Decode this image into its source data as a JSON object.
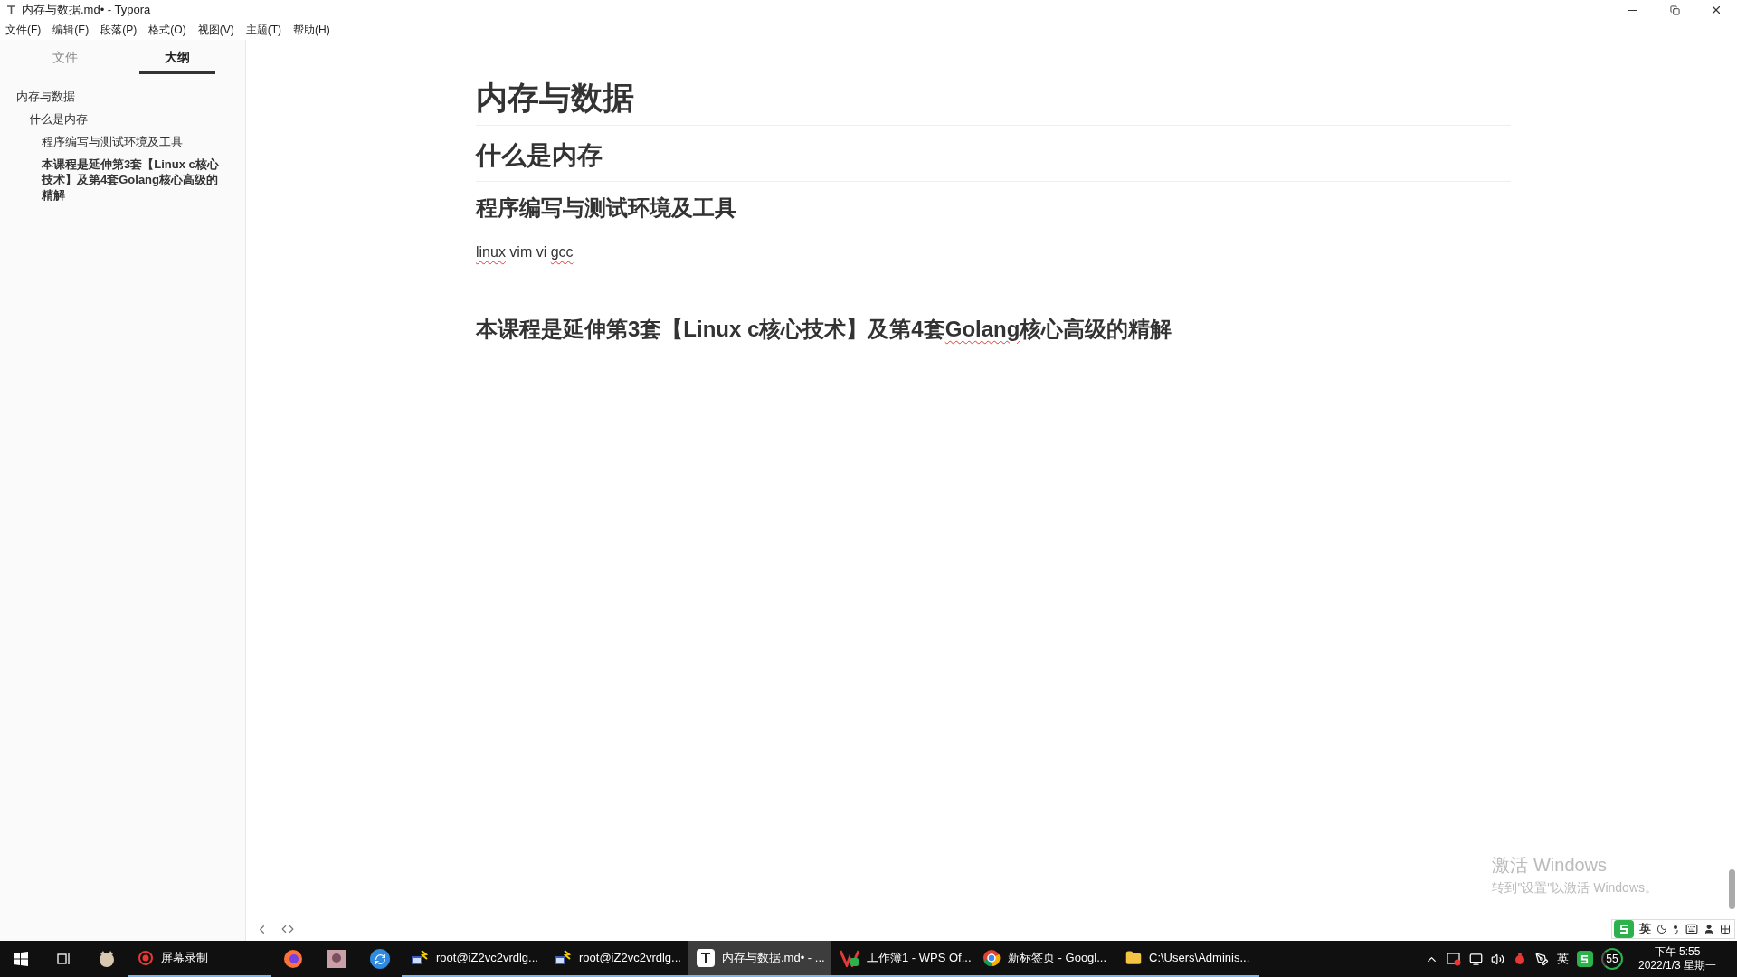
{
  "window": {
    "title": "内存与数据.md• - Typora"
  },
  "menu": [
    "文件(F)",
    "编辑(E)",
    "段落(P)",
    "格式(O)",
    "视图(V)",
    "主题(T)",
    "帮助(H)"
  ],
  "sidebar": {
    "tabs": [
      {
        "label": "文件",
        "selected": false
      },
      {
        "label": "大纲",
        "selected": true
      }
    ],
    "outline": [
      {
        "label": "内存与数据",
        "selected": false,
        "children": [
          {
            "label": "什么是内存",
            "selected": false,
            "children": [
              {
                "label": "程序编写与测试环境及工具",
                "selected": false
              },
              {
                "label": "本课程是延伸第3套【Linux c核心技术】及第4套Golang核心高级的精解",
                "selected": true
              }
            ]
          }
        ]
      }
    ]
  },
  "document": [
    {
      "kind": "h1",
      "segments": [
        {
          "text": "内存与数据",
          "misspelled": false
        }
      ]
    },
    {
      "kind": "h2",
      "segments": [
        {
          "text": "什么是内存",
          "misspelled": false
        }
      ]
    },
    {
      "kind": "h3",
      "segments": [
        {
          "text": "程序编写与测试环境及工具",
          "misspelled": false
        }
      ]
    },
    {
      "kind": "p",
      "segments": [
        {
          "text": "linux",
          "misspelled": true
        },
        {
          "text": " vim vi ",
          "misspelled": false
        },
        {
          "text": "gcc",
          "misspelled": true
        }
      ]
    },
    {
      "kind": "h3",
      "segments": [
        {
          "text": "本课程是延伸第3套【Linux c核心技术】及第4套",
          "misspelled": false
        },
        {
          "text": "Golang",
          "misspelled": true
        },
        {
          "text": "核心高级的精解",
          "misspelled": false
        }
      ]
    }
  ],
  "activation": {
    "title": "激活 Windows",
    "subtitle": "转到\"设置\"以激活 Windows。"
  },
  "ime_bar": {
    "language": "英"
  },
  "taskbar": {
    "items": [
      {
        "kind": "icon",
        "selected": false
      },
      {
        "kind": "app",
        "label": "屏幕录制",
        "selected": false
      },
      {
        "kind": "icon",
        "selected": false
      },
      {
        "kind": "icon",
        "selected": false
      },
      {
        "kind": "icon",
        "selected": false
      },
      {
        "kind": "app",
        "label": "root@iZ2vc2vrdlg...",
        "selected": false
      },
      {
        "kind": "app",
        "label": "root@iZ2vc2vrdlg...",
        "selected": false
      },
      {
        "kind": "app",
        "label": "内存与数据.md• - ...",
        "selected": true
      },
      {
        "kind": "app",
        "label": "工作簿1 - WPS Of...",
        "selected": false
      },
      {
        "kind": "app",
        "label": "新标签页 - Googl...",
        "selected": false
      },
      {
        "kind": "app",
        "label": "C:\\Users\\Adminis...",
        "selected": false
      }
    ],
    "tray": {
      "language": "英",
      "badge": "55",
      "time": "下午 5:55",
      "date": "2022/1/3 星期一"
    }
  }
}
